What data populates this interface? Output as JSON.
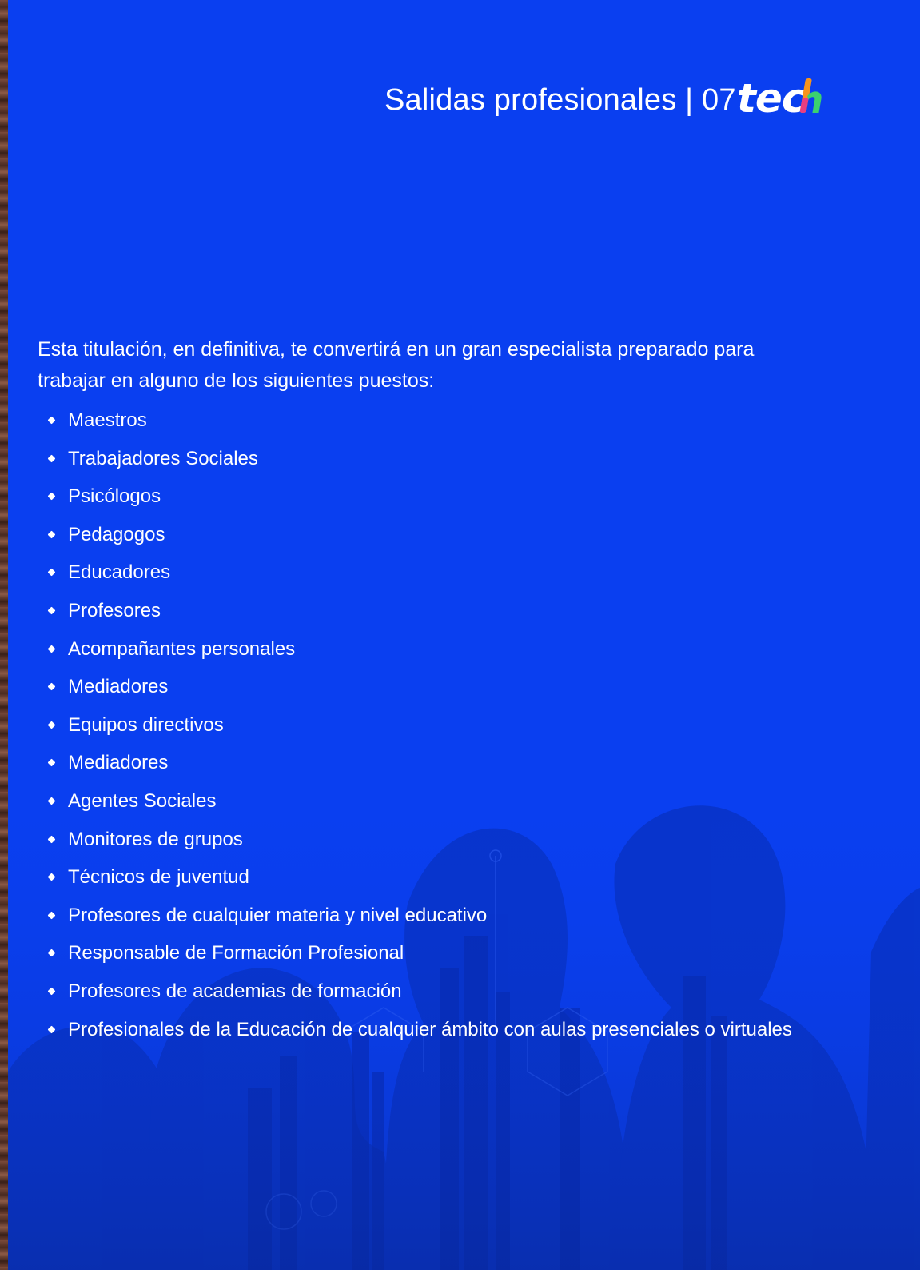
{
  "header": {
    "title": "Salidas profesionales | 07",
    "logo_text": "tech"
  },
  "intro": "Esta titulación, en definitiva, te convertirá en un gran especialista preparado para trabajar en alguno de los siguientes puestos:",
  "careers": [
    "Maestros",
    "Trabajadores Sociales",
    "Psicólogos",
    "Pedagogos",
    "Educadores",
    "Profesores",
    "Acompañantes personales",
    "Mediadores",
    "Equipos directivos",
    "Mediadores",
    "Agentes Sociales",
    "Monitores de grupos",
    "Técnicos de juventud",
    "Profesores de cualquier materia y nivel educativo",
    "Responsable de Formación Profesional",
    "Profesores de academias de formación",
    "Profesionales de la Educación de cualquier ámbito con aulas presenciales o virtuales"
  ],
  "colors": {
    "background": "#0a3ff0",
    "text": "#ffffff",
    "logo_accent_orange": "#f7941d",
    "logo_accent_green": "#3bd16f",
    "logo_accent_pink": "#e93d82"
  }
}
